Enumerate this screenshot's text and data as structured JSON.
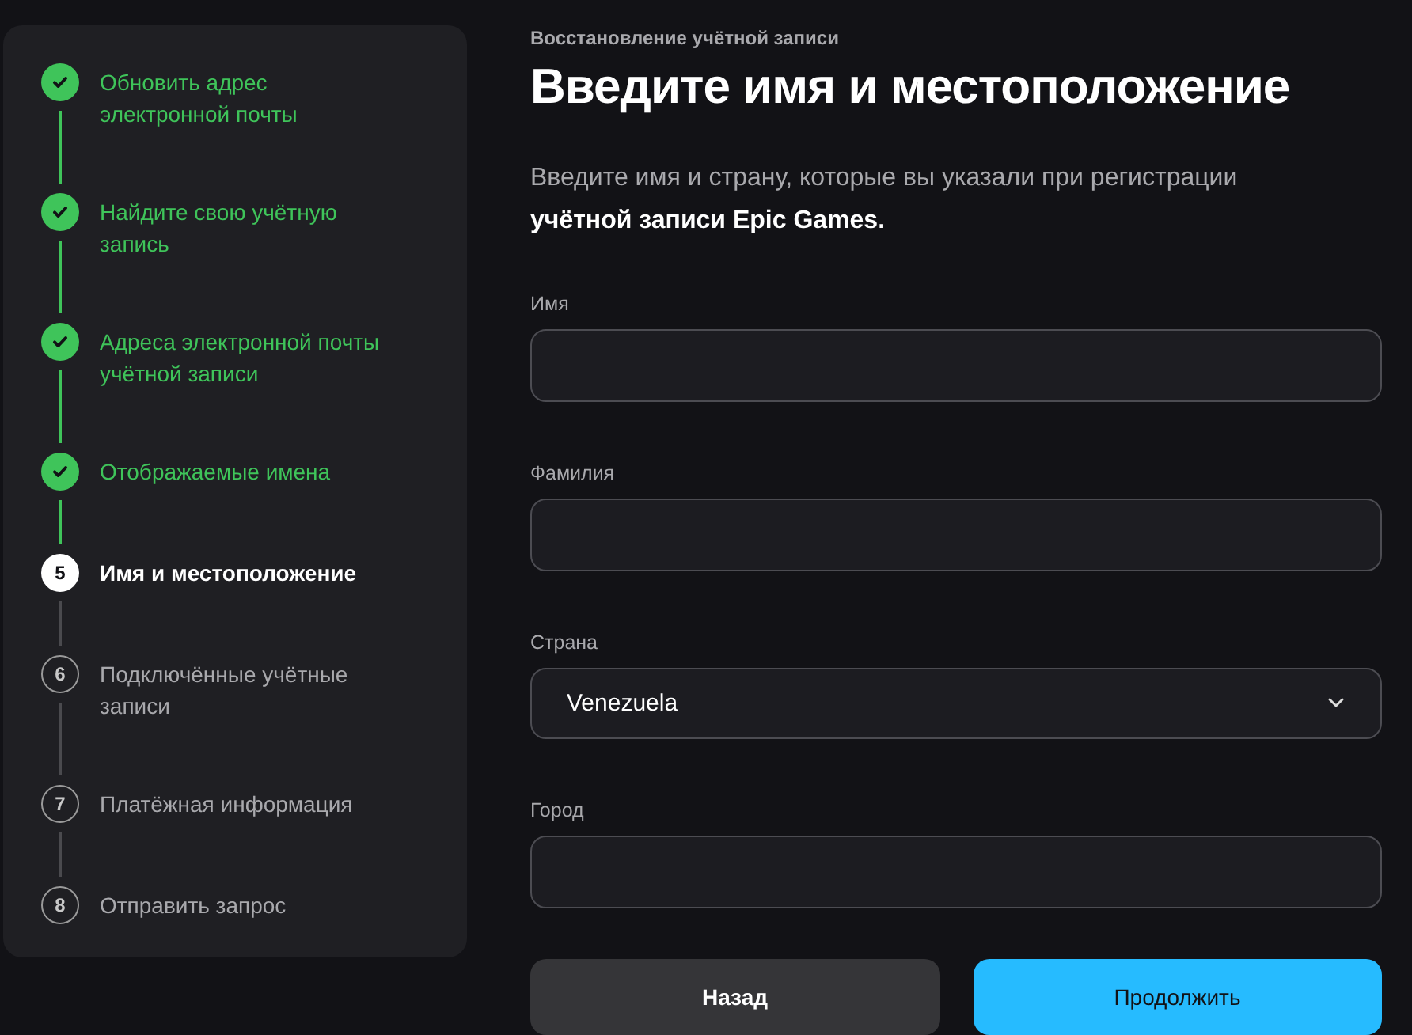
{
  "steps": [
    {
      "label": "Обновить адрес электронной почты",
      "completed": true,
      "selected": false
    },
    {
      "label": "Найдите свою учётную запись",
      "completed": true,
      "selected": false
    },
    {
      "label": "Адреса электронной почты учётной записи",
      "completed": true,
      "selected": false
    },
    {
      "label": "Отображаемые имена",
      "completed": true,
      "selected": false
    },
    {
      "number": "5",
      "label": "Имя и местоположение",
      "completed": false,
      "selected": true
    },
    {
      "number": "6",
      "label": "Подключённые учётные записи",
      "completed": false,
      "selected": false
    },
    {
      "number": "7",
      "label": "Платёжная информация",
      "completed": false,
      "selected": false
    },
    {
      "number": "8",
      "label": "Отправить запрос",
      "completed": false,
      "selected": false
    }
  ],
  "form": {
    "eyebrow": "Восстановление учётной записи",
    "title": "Введите имя и местоположение",
    "description": "Введите имя и страну, которые вы указали при регистрации **учётной записи Epic Games.**",
    "fields": [
      {
        "kind": "text",
        "label": "Имя"
      },
      {
        "kind": "text",
        "label": "Фамилия"
      },
      {
        "kind": "select",
        "label": "Страна",
        "value": "Venezuela"
      },
      {
        "kind": "text",
        "label": "Город"
      }
    ],
    "buttons": [
      {
        "kind": "secondary",
        "label": "Назад"
      },
      {
        "kind": "primary",
        "label": "Продолжить"
      }
    ]
  }
}
